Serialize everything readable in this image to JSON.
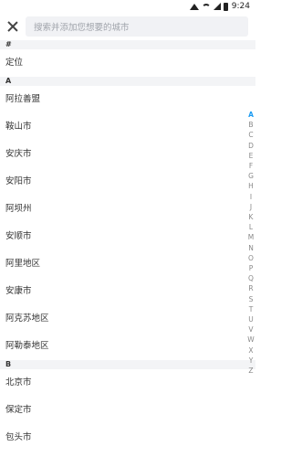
{
  "status_bar": {
    "time": "9:24"
  },
  "search": {
    "placeholder": "搜索并添加您想要的城市"
  },
  "sections": [
    {
      "letter": "#",
      "cities": [
        "定位"
      ]
    },
    {
      "letter": "A",
      "cities": [
        "阿拉善盟",
        "鞍山市",
        "安庆市",
        "安阳市",
        "阿坝州",
        "安顺市",
        "阿里地区",
        "安康市",
        "阿克苏地区",
        "阿勒泰地区"
      ]
    },
    {
      "letter": "B",
      "cities": [
        "北京市",
        "保定市",
        "包头市"
      ]
    }
  ],
  "index_letters": [
    "A",
    "B",
    "C",
    "D",
    "E",
    "F",
    "G",
    "H",
    "I",
    "J",
    "K",
    "L",
    "M",
    "N",
    "O",
    "P",
    "Q",
    "R",
    "S",
    "T",
    "U",
    "V",
    "W",
    "X",
    "Y",
    "Z"
  ],
  "colors": {
    "accent": "#1a9bf2",
    "section_bg": "#f3f4f6",
    "search_bg": "#f1f2f5"
  }
}
